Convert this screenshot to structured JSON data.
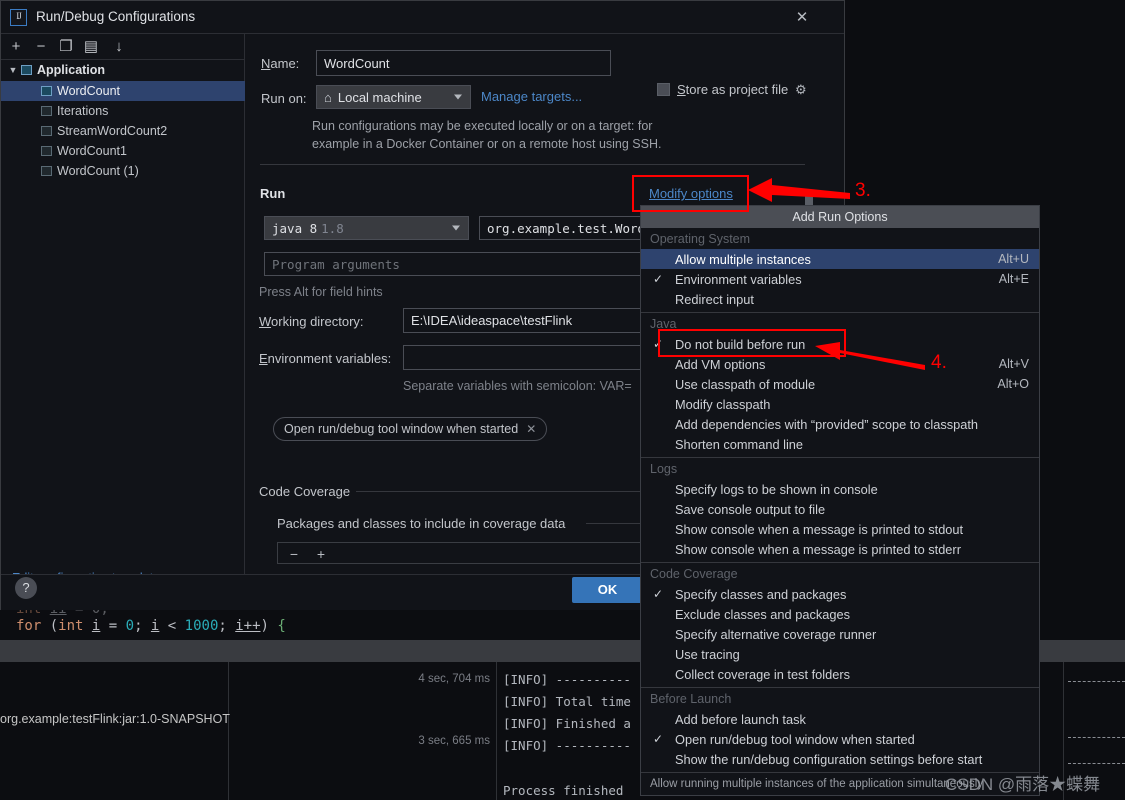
{
  "dialog": {
    "title": "Run/Debug Configurations",
    "icon": "intellij-idea-icon",
    "close_label": "✕"
  },
  "tree_toolbar": [
    {
      "name": "add-configuration-button",
      "glyph": "+"
    },
    {
      "name": "remove-configuration-button",
      "glyph": "−"
    },
    {
      "name": "copy-configuration-button",
      "glyph": "❐"
    },
    {
      "name": "new-folder-button",
      "glyph": "▤"
    },
    {
      "name": "sort-configurations-button",
      "glyph": "↓"
    }
  ],
  "tree": {
    "root": {
      "label": "Application",
      "expanded": true
    },
    "items": [
      {
        "label": "WordCount",
        "selected": true
      },
      {
        "label": "Iterations",
        "selected": false
      },
      {
        "label": "StreamWordCount2",
        "selected": false
      },
      {
        "label": "WordCount1",
        "selected": false
      },
      {
        "label": "WordCount (1)",
        "selected": false
      }
    ],
    "edit_templates_link": "Edit configuration templates..."
  },
  "form": {
    "name_label": "Name:",
    "name_value": "WordCount",
    "store_as_project_file_label": "Store as project file",
    "run_on_label": "Run on:",
    "run_on_value": "Local machine",
    "manage_targets_link": "Manage targets...",
    "description_line1": "Run configurations may be executed locally or on a target: for",
    "description_line2": "example in a Docker Container or on a remote host using SSH.",
    "run_section_title": "Run",
    "modify_options_link": "Modify options",
    "jre_value": "java 8",
    "jre_version": "1.8",
    "main_class_value": "org.example.test.WordC",
    "program_arguments_placeholder": "Program arguments",
    "field_hint": "Press Alt for field hints",
    "working_directory_label": "Working directory:",
    "working_directory_value": "E:\\IDEA\\ideaspace\\testFlink",
    "environment_variables_label": "Environment variables:",
    "environment_variables_value": "",
    "env_hint": "Separate variables with semicolon: VAR=",
    "open_tool_window_pill": "Open run/debug tool window when started",
    "code_coverage_title": "Code Coverage",
    "coverage_subtitle": "Packages and classes to include in coverage data",
    "coverage_remove_glyph": "−",
    "coverage_add_glyph": "+"
  },
  "footer": {
    "help_label": "?",
    "ok_label": "OK"
  },
  "popup": {
    "title": "Add Run Options",
    "footer_hint": "Allow running multiple instances of the application simultaneously",
    "groups": [
      {
        "title": "Operating System",
        "items": [
          {
            "label": "Allow multiple instances",
            "checked": false,
            "accel": "Alt+U",
            "highlighted": true
          },
          {
            "label": "Environment variables",
            "checked": true,
            "accel": "Alt+E",
            "highlighted": false
          },
          {
            "label": "Redirect input",
            "checked": false,
            "accel": "",
            "highlighted": false
          }
        ]
      },
      {
        "title": "Java",
        "items": [
          {
            "label": "Do not build before run",
            "checked": true,
            "accel": "",
            "highlighted": false
          },
          {
            "label": "Add VM options",
            "checked": false,
            "accel": "Alt+V",
            "highlighted": false
          },
          {
            "label": "Use classpath of module",
            "checked": false,
            "accel": "Alt+O",
            "highlighted": false
          },
          {
            "label": "Modify classpath",
            "checked": false,
            "accel": "",
            "highlighted": false
          },
          {
            "label": "Add dependencies with “provided” scope to classpath",
            "checked": false,
            "accel": "",
            "highlighted": false
          },
          {
            "label": "Shorten command line",
            "checked": false,
            "accel": "",
            "highlighted": false
          }
        ]
      },
      {
        "title": "Logs",
        "items": [
          {
            "label": "Specify logs to be shown in console",
            "checked": false,
            "accel": "",
            "highlighted": false
          },
          {
            "label": "Save console output to file",
            "checked": false,
            "accel": "",
            "highlighted": false
          },
          {
            "label": "Show console when a message is printed to stdout",
            "checked": false,
            "accel": "",
            "highlighted": false
          },
          {
            "label": "Show console when a message is printed to stderr",
            "checked": false,
            "accel": "",
            "highlighted": false
          }
        ]
      },
      {
        "title": "Code Coverage",
        "items": [
          {
            "label": "Specify classes and packages",
            "checked": true,
            "accel": "",
            "highlighted": false
          },
          {
            "label": "Exclude classes and packages",
            "checked": false,
            "accel": "",
            "highlighted": false
          },
          {
            "label": "Specify alternative coverage runner",
            "checked": false,
            "accel": "",
            "highlighted": false
          },
          {
            "label": "Use tracing",
            "checked": false,
            "accel": "",
            "highlighted": false
          },
          {
            "label": "Collect coverage in test folders",
            "checked": false,
            "accel": "",
            "highlighted": false
          }
        ]
      },
      {
        "title": "Before Launch",
        "items": [
          {
            "label": "Add before launch task",
            "checked": false,
            "accel": "",
            "highlighted": false
          },
          {
            "label": "Open run/debug tool window when started",
            "checked": true,
            "accel": "",
            "highlighted": false
          },
          {
            "label": "Show the run/debug configuration settings before start",
            "checked": false,
            "accel": "",
            "highlighted": false
          }
        ]
      }
    ]
  },
  "annotations": {
    "step3": "3.",
    "step4": "4.",
    "accent_color": "#ff0000"
  },
  "ide_background": {
    "code_line_parts": [
      "for",
      " (",
      "int",
      " ",
      "i",
      " = ",
      "0",
      "; ",
      "i",
      " < ",
      "1000",
      "; ",
      "i++",
      ") ",
      "{"
    ],
    "maven_coordinate": "org.example:testFlink:jar:1.0-SNAPSHOT",
    "times": [
      "4 sec, 704 ms",
      "3 sec, 665 ms"
    ],
    "console_lines": [
      "[INFO] ----------",
      "[INFO] Total time",
      "[INFO] Finished a",
      "[INFO] ----------",
      "Process finished"
    ],
    "watermark": "CSDN @雨落★蝶舞"
  }
}
